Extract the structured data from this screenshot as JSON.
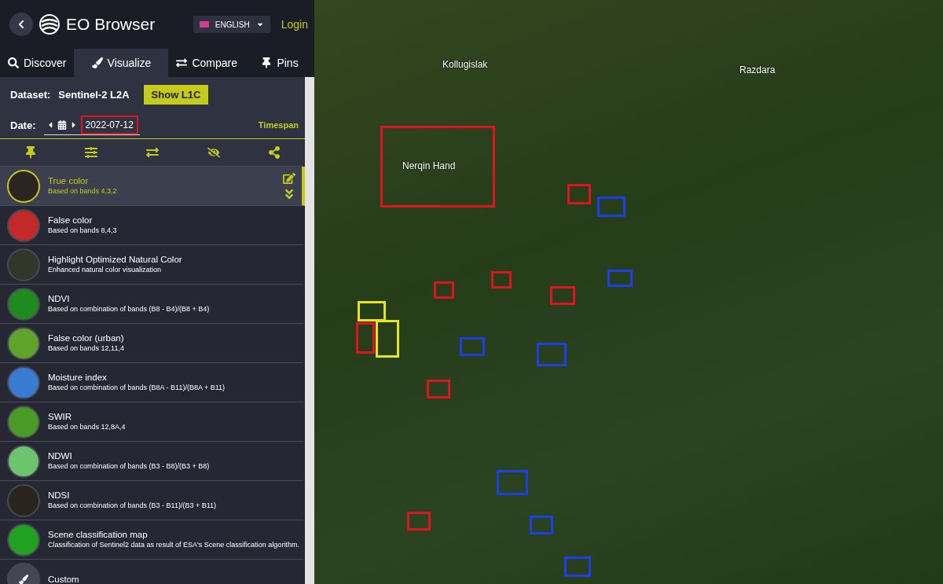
{
  "header": {
    "title": "EO Browser",
    "language": "ENGLISH",
    "login": "Login"
  },
  "tabs": [
    {
      "label": "Discover",
      "selected": false
    },
    {
      "label": "Visualize",
      "selected": true
    },
    {
      "label": "Compare",
      "selected": false
    },
    {
      "label": "Pins",
      "selected": false
    }
  ],
  "dataset": {
    "label": "Dataset:",
    "value": "Sentinel-2 L2A",
    "button": "Show L1C"
  },
  "date": {
    "label": "Date:",
    "value": "2022-07-12",
    "timespan": "Timespan"
  },
  "layers": [
    {
      "name": "True color",
      "description": "Based on bands 4,3,2",
      "selected": true
    },
    {
      "name": "False color",
      "description": "Based on bands 8,4,3",
      "selected": false
    },
    {
      "name": "Highlight Optimized Natural Color",
      "description": "Enhanced natural color visualization",
      "selected": false
    },
    {
      "name": "NDVI",
      "description": "Based on combination of bands (B8 - B4)/(B8 + B4)",
      "selected": false
    },
    {
      "name": "False color (urban)",
      "description": "Based on bands 12,11,4",
      "selected": false
    },
    {
      "name": "Moisture index",
      "description": "Based on combination of bands (B8A - B11)/(B8A + B11)",
      "selected": false
    },
    {
      "name": "SWIR",
      "description": "Based on bands 12,8A,4",
      "selected": false
    },
    {
      "name": "NDWI",
      "description": "Based on combination of bands (B3 - B8)/(B3 + B8)",
      "selected": false
    },
    {
      "name": "NDSI",
      "description": "Based on combination of bands (B3 - B11)/(B3 + B11)",
      "selected": false
    },
    {
      "name": "Scene classification map",
      "description": "Classification of Sentinel2 data as result of ESA's Scene classification algorithm.",
      "selected": false
    },
    {
      "name": "Custom",
      "selected": false
    }
  ],
  "map_labels": [
    "Kollugislak",
    "Razdara",
    "Nerqin Hand"
  ],
  "markers": [
    {
      "color": "#e0141e"
    },
    {
      "color": "#e0141e"
    },
    {
      "color": "#1e3ee6"
    },
    {
      "color": "#e0141e"
    },
    {
      "color": "#e0141e"
    },
    {
      "color": "#e0141e"
    },
    {
      "color": "#1e3ee6"
    },
    {
      "color": "#e8e41c"
    },
    {
      "color": "#e0141e"
    },
    {
      "color": "#e8e41c"
    },
    {
      "color": "#1e3ee6"
    },
    {
      "color": "#1e3ee6"
    },
    {
      "color": "#e0141e"
    },
    {
      "color": "#1e3ee6"
    },
    {
      "color": "#e0141e"
    },
    {
      "color": "#1e3ee6"
    },
    {
      "color": "#1e3ee6"
    }
  ]
}
